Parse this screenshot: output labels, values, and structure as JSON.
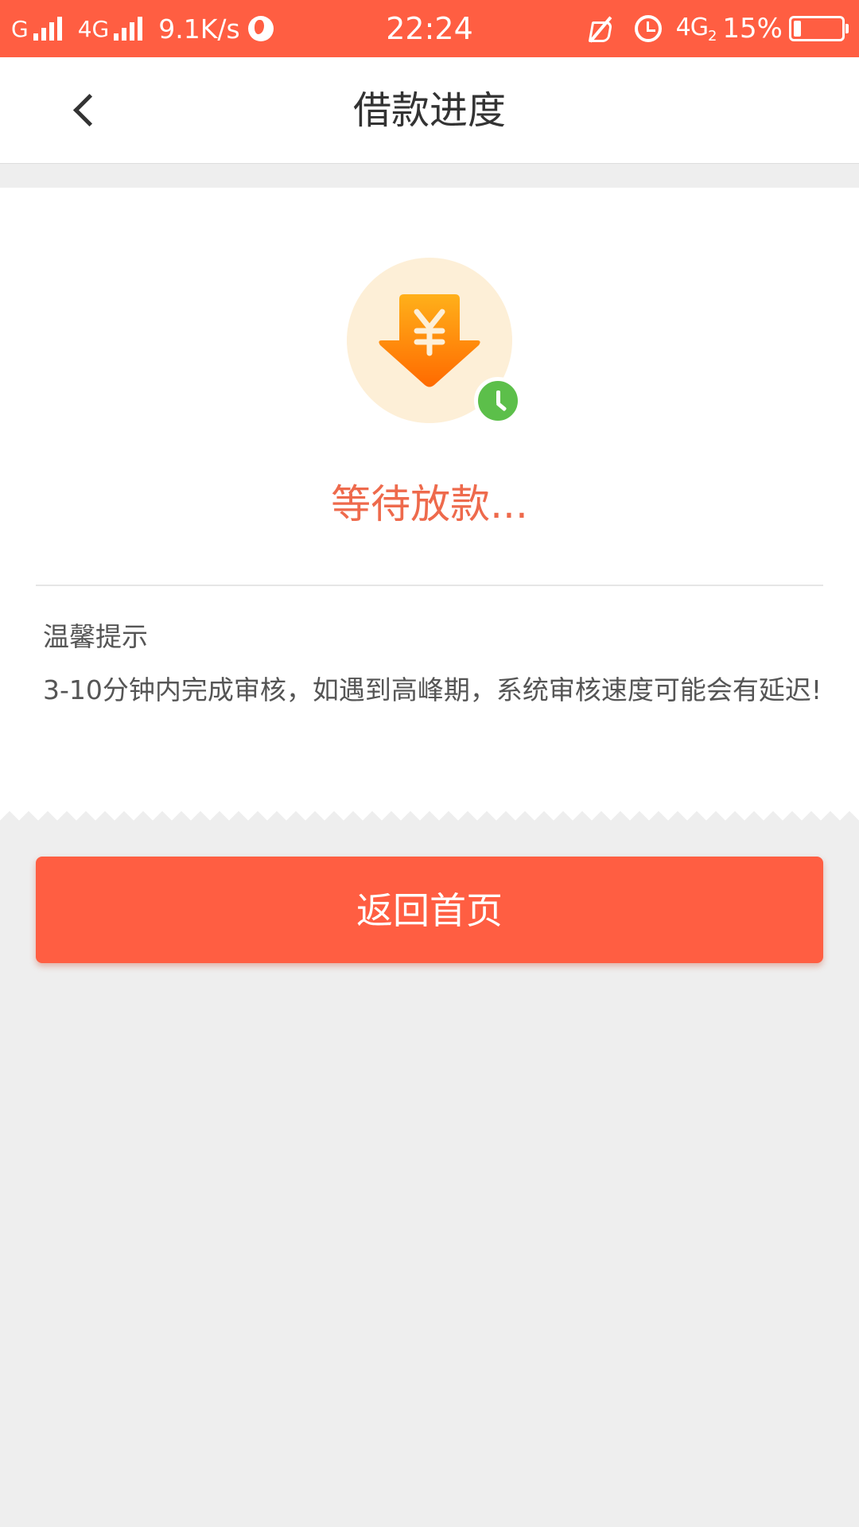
{
  "status_bar": {
    "network_1": "G",
    "network_2": "4G",
    "speed": "9.1K/s",
    "time": "22:24",
    "network_3": "4G",
    "network_3_sub": "2",
    "battery_percent": "15%",
    "battery_level": 0.15
  },
  "header": {
    "title": "借款进度"
  },
  "status": {
    "text": "等待放款..."
  },
  "tip": {
    "title": "温馨提示",
    "body": "3-10分钟内完成审核，如遇到高峰期，系统审核速度可能会有延迟!"
  },
  "actions": {
    "home_label": "返回首页"
  },
  "colors": {
    "accent": "#ff5e42",
    "status_text": "#ee6a4c",
    "badge_green": "#5cbf4a",
    "icon_bg": "#fdefd7"
  }
}
